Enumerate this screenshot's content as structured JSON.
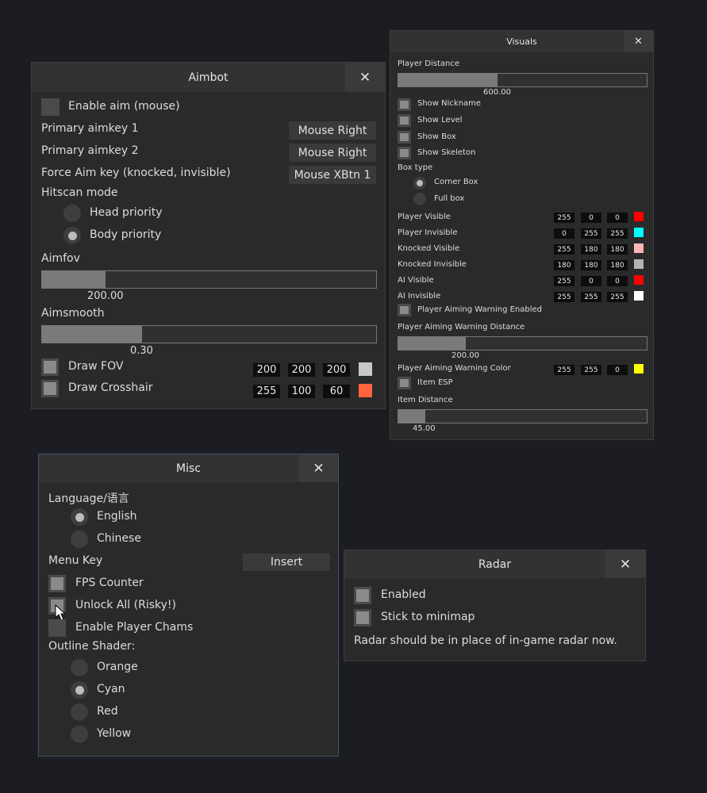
{
  "aimbot": {
    "title": "Aimbot",
    "enable_aim_label": "Enable aim (mouse)",
    "primary_key1_label": "Primary aimkey 1",
    "primary_key1_value": "Mouse Right",
    "primary_key2_label": "Primary aimkey 2",
    "primary_key2_value": "Mouse Right",
    "force_aim_label": "Force Aim key (knocked, invisible)",
    "force_aim_value": "Mouse XBtn 1",
    "hitscan_label": "Hitscan mode",
    "hitscan_options": [
      "Head priority",
      "Body priority"
    ],
    "hitscan_selected": "Body priority",
    "aimfov_label": "Aimfov",
    "aimfov_value": "200.00",
    "aimfov_fraction": 0.19,
    "aimsmooth_label": "Aimsmooth",
    "aimsmooth_value": "0.30",
    "aimsmooth_fraction": 0.3,
    "draw_fov_label": "Draw FOV",
    "draw_fov_rgb": [
      "200",
      "200",
      "200"
    ],
    "draw_fov_color": "#c8c8c8",
    "draw_crosshair_label": "Draw Crosshair",
    "draw_crosshair_rgb": [
      "255",
      "100",
      "60"
    ],
    "draw_crosshair_color": "#ff643c"
  },
  "visuals": {
    "title": "Visuals",
    "player_distance_label": "Player Distance",
    "player_distance_value": "600.00",
    "player_distance_fraction": 0.4,
    "show_nickname": "Show Nickname",
    "show_level": "Show Level",
    "show_box": "Show Box",
    "show_skeleton": "Show Skeleton",
    "box_type_label": "Box type",
    "box_types": [
      "Corner Box",
      "Full box"
    ],
    "box_type_selected": "Corner Box",
    "colors": [
      {
        "label": "Player Visible",
        "rgb": [
          "255",
          "0",
          "0"
        ],
        "color": "#ff0000"
      },
      {
        "label": "Player Invisible",
        "rgb": [
          "0",
          "255",
          "255"
        ],
        "color": "#00ffff"
      },
      {
        "label": "Knocked Visible",
        "rgb": [
          "255",
          "180",
          "180"
        ],
        "color": "#ffb4b4"
      },
      {
        "label": "Knocked Invisible",
        "rgb": [
          "180",
          "180",
          "180"
        ],
        "color": "#b4b4b4"
      },
      {
        "label": "AI Visible",
        "rgb": [
          "255",
          "0",
          "0"
        ],
        "color": "#ff0000"
      },
      {
        "label": "AI Invisible",
        "rgb": [
          "255",
          "255",
          "255"
        ],
        "color": "#ffffff"
      }
    ],
    "aiming_warning_enabled": "Player Aiming Warning Enabled",
    "aiming_warning_distance_label": "Player Aiming Warning Distance",
    "aiming_warning_distance_value": "200.00",
    "aiming_warning_distance_fraction": 0.27,
    "aiming_warning_color_label": "Player Aiming Warning Color",
    "aiming_warning_rgb": [
      "255",
      "255",
      "0"
    ],
    "aiming_warning_color": "#ffff00",
    "item_esp": "Item ESP",
    "item_distance_label": "Item Distance",
    "item_distance_value": "45.00",
    "item_distance_fraction": 0.11
  },
  "misc": {
    "title": "Misc",
    "language_label": "Language/语言",
    "languages": [
      "English",
      "Chinese"
    ],
    "language_selected": "English",
    "menu_key_label": "Menu Key",
    "menu_key_value": "Insert",
    "fps_counter": "FPS Counter",
    "unlock_all": "Unlock All (Risky!)",
    "enable_chams": "Enable Player Chams",
    "outline_label": "Outline Shader:",
    "outline_options": [
      "Orange",
      "Cyan",
      "Red",
      "Yellow"
    ],
    "outline_selected": "Cyan"
  },
  "radar": {
    "title": "Radar",
    "enabled": "Enabled",
    "stick_minimap": "Stick to minimap",
    "note": "Radar should be in place of in-game radar now."
  },
  "close_glyph": "✕"
}
